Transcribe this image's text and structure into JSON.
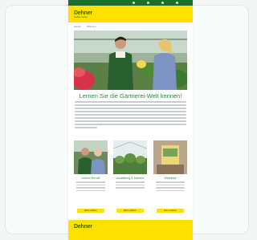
{
  "email": {
    "logo": "Dehner",
    "logo_sub": "Garten-Center",
    "nav": [
      "Garten",
      "Pflanzen"
    ],
    "headline": "Lernen Sie die Gärtnerei-Welt kennen!",
    "tiles": [
      {
        "title": "Unsere Berufe",
        "button": "Mehr erfahren"
      },
      {
        "title": "Ausbildung & Karriere",
        "button": "Mehr erfahren"
      },
      {
        "title": "Webshop",
        "button": "Mehr erfahren"
      }
    ],
    "footer_logo": "Dehner"
  },
  "colors": {
    "brand_yellow": "#ffe000",
    "brand_green": "#1e6b34",
    "headline_green": "#2e8b3e"
  }
}
